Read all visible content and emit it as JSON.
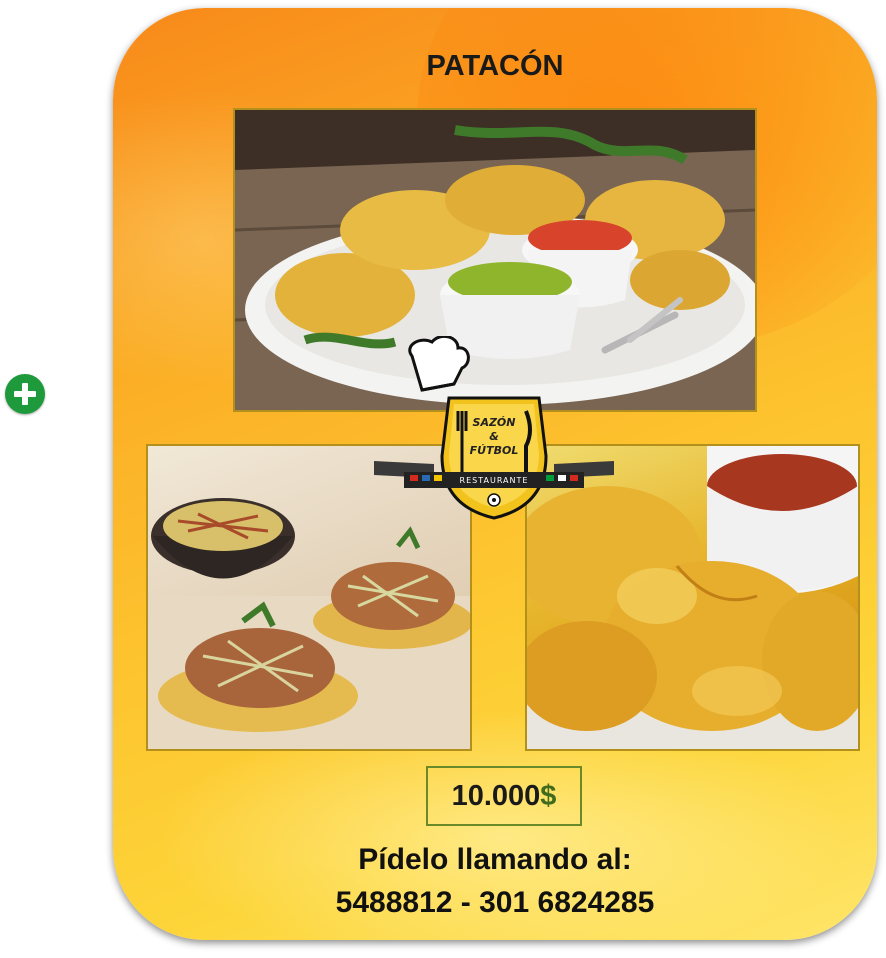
{
  "card": {
    "title": "PATACÓN",
    "price": {
      "amount": "10.000",
      "currency": "$"
    },
    "order_label": "Pídelo llamando al:",
    "phones": "5488812 - 301 6824285"
  },
  "logo": {
    "name_line1": "SAZÓN",
    "name_line2": "&",
    "name_line3": "FÚTBOL",
    "band": "RESTAURANTE"
  },
  "colors": {
    "add_button": "#1e9a3c",
    "price_currency": "#3e6b1c",
    "card_top": "#f8891a",
    "card_bottom": "#fee56a",
    "frame_border": "#b3901b"
  },
  "icons": {
    "add": "plus-circle-icon",
    "logo": "chef-hat-icon"
  }
}
